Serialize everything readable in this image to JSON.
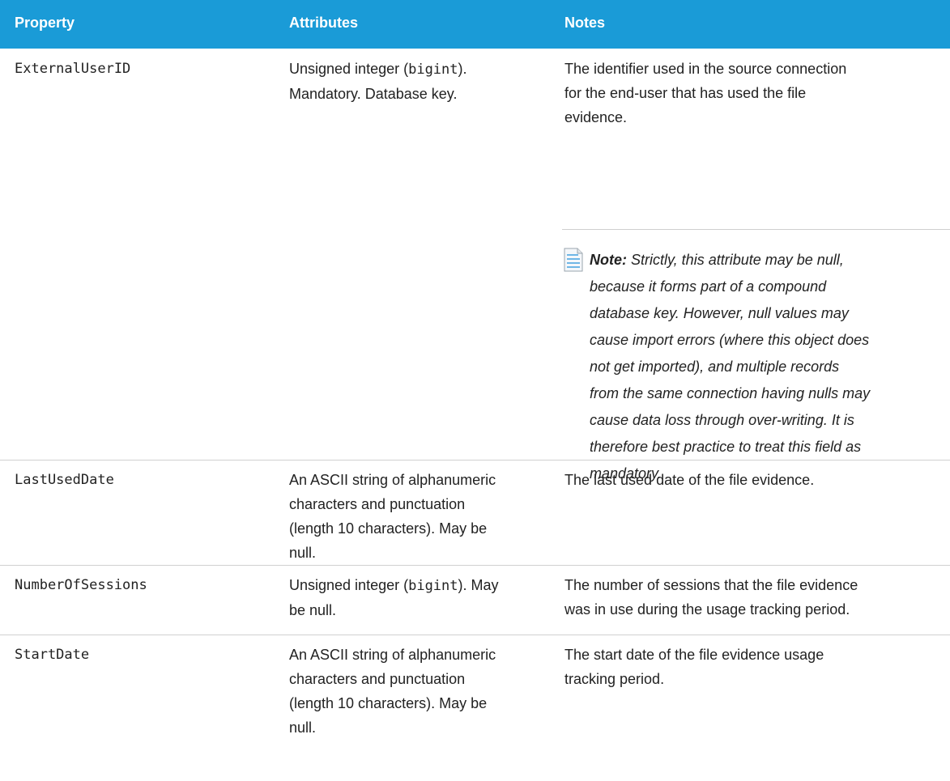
{
  "table": {
    "headers": [
      "Property",
      "Attributes",
      "Notes"
    ],
    "rows": [
      {
        "property": "ExternalUserID",
        "attr_pre": "Unsigned integer (",
        "attr_code": "bigint",
        "attr_post_line1": ").",
        "attr_line2": "Mandatory. Database key.",
        "notes_lines": [
          "The identifier used in the source connection",
          "for the end-user that has used the file",
          "evidence."
        ],
        "note": {
          "label": "Note:",
          "lines": [
            "Strictly, this attribute may be null,",
            "because it forms part of a compound",
            "database key. However, null values may",
            "cause import errors (where this object does",
            "not get imported), and multiple records",
            "from the same connection having nulls may",
            "cause data loss through over-writing. It is",
            "therefore best practice to treat this field as",
            "mandatory."
          ]
        }
      },
      {
        "property": "LastUsedDate",
        "attr_lines": [
          "An ASCII string of alphanumeric",
          "characters and punctuation",
          "(length 10 characters). May be",
          "null."
        ],
        "notes_lines": [
          "The last used date of the file evidence."
        ]
      },
      {
        "property": "NumberOfSessions",
        "attr_pre": "Unsigned integer (",
        "attr_code": "bigint",
        "attr_post_line1": "). May",
        "attr_line2": "be null.",
        "notes_lines": [
          "The number of sessions that the file evidence",
          "was in use during the usage tracking period."
        ]
      },
      {
        "property": "StartDate",
        "attr_lines": [
          "An ASCII string of alphanumeric",
          "characters and punctuation",
          "(length 10 characters). May be",
          "null."
        ],
        "notes_lines": [
          "The start date of the file evidence usage",
          "tracking period."
        ]
      }
    ]
  }
}
